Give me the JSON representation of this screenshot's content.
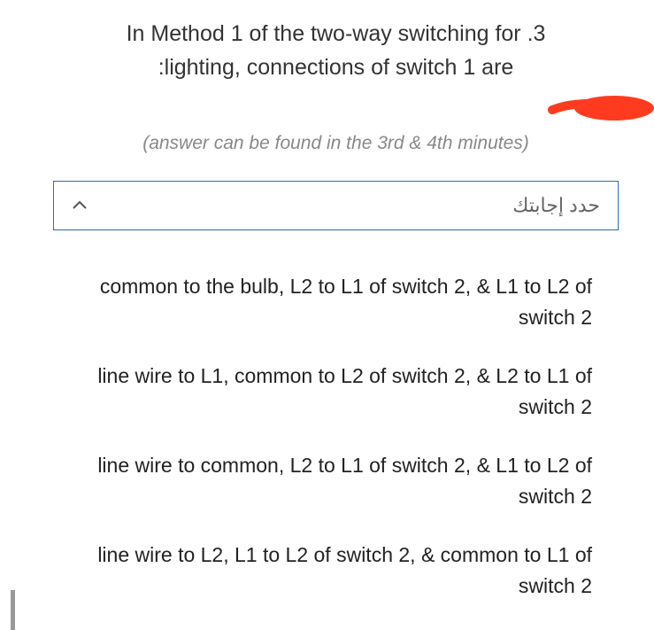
{
  "question": {
    "line1": "In Method 1 of the two-way switching for .3",
    "line2": ":lighting, connections of switch 1 are"
  },
  "hint": "(answer can be found in the 3rd & 4th minutes)",
  "dropdown": {
    "placeholder": "حدد إجابتك"
  },
  "options": [
    "common to the bulb, L2 to L1 of switch 2, & L1 to L2 of switch 2",
    "line wire to L1, common to L2 of switch 2, & L2 to L1 of switch 2",
    "line wire to common, L2 to L1 of switch 2, & L1 to L2 of switch 2",
    "line wire to L2, L1 to L2 of switch 2, & common to L1 of switch 2"
  ],
  "colors": {
    "border": "#2e6bb8",
    "highlight": "#ff3b1f"
  }
}
